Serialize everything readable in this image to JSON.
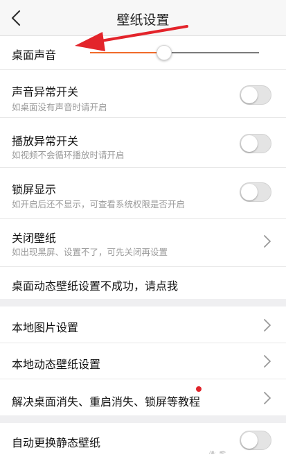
{
  "header": {
    "title": "壁纸设置"
  },
  "desktop_sound": {
    "label": "桌面声音",
    "volume_fraction": 0.44
  },
  "settings": [
    {
      "title": "声音异常开关",
      "subtitle": "如桌面没有声音时请开启",
      "type": "toggle",
      "on": false
    },
    {
      "title": "播放异常开关",
      "subtitle": "如视频不会循环播放时请开启",
      "type": "toggle",
      "on": false
    },
    {
      "title": "锁屏显示",
      "subtitle": "如开启后还不显示，可查看系统权限是否开启",
      "type": "toggle",
      "on": false
    },
    {
      "title": "关闭壁纸",
      "subtitle": "如出现黑屏、设置不了，可先关闭再设置",
      "type": "link"
    },
    {
      "title": "桌面动态壁纸设置不成功，请点我",
      "type": "text"
    }
  ],
  "section2": [
    {
      "title": "本地图片设置",
      "type": "link"
    },
    {
      "title": "本地动态壁纸设置",
      "type": "link"
    },
    {
      "title": "解决桌面消失、重启消失、锁屏等教程",
      "type": "link",
      "badge": true
    }
  ],
  "section3": [
    {
      "title": "自动更换静态壁纸",
      "type": "toggle",
      "on": false
    }
  ],
  "colors": {
    "accent": "#f06a2a",
    "annotation_arrow": "#e3242b",
    "badge": "#e0242b"
  }
}
